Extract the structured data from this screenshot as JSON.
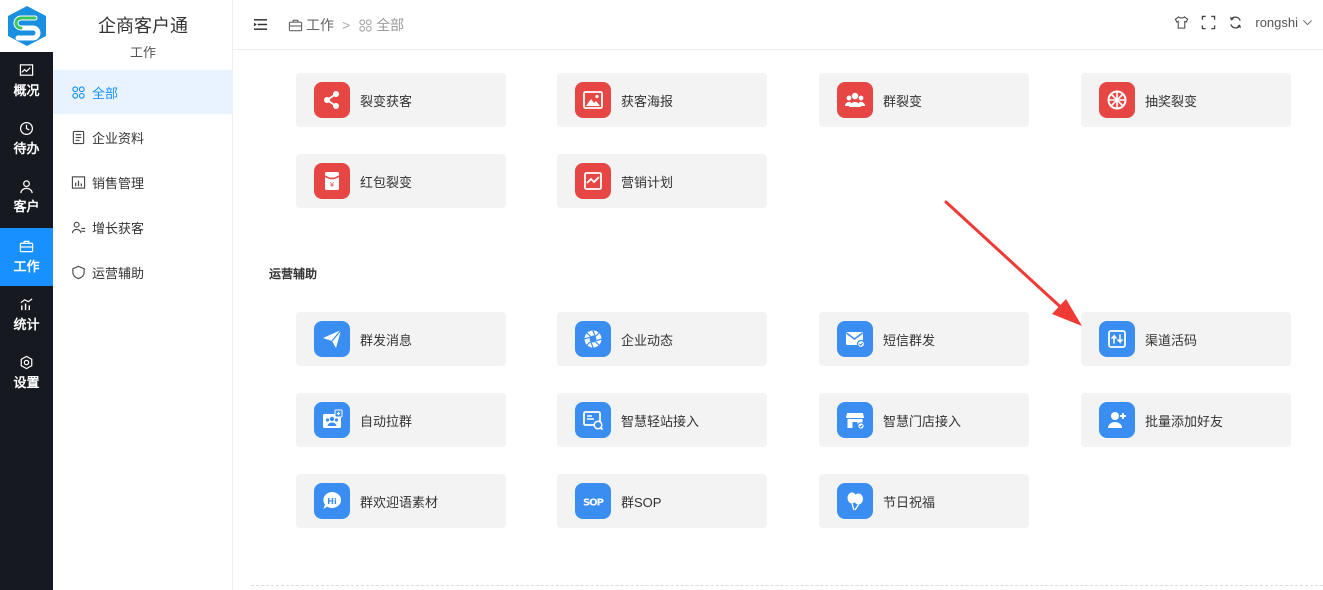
{
  "rail": {
    "items": [
      {
        "label": "概况",
        "icon": "chart-icon"
      },
      {
        "label": "待办",
        "icon": "clock-icon"
      },
      {
        "label": "客户",
        "icon": "user-icon"
      },
      {
        "label": "工作",
        "icon": "briefcase-icon"
      },
      {
        "label": "统计",
        "icon": "stats-icon"
      },
      {
        "label": "设置",
        "icon": "gear-icon"
      }
    ],
    "active_index": 3
  },
  "sidebar": {
    "brand": "企商客户通",
    "subtitle": "工作",
    "items": [
      {
        "label": "全部",
        "icon": "grid-icon"
      },
      {
        "label": "企业资料",
        "icon": "document-icon"
      },
      {
        "label": "销售管理",
        "icon": "chart-board-icon"
      },
      {
        "label": "增长获客",
        "icon": "users-icon"
      },
      {
        "label": "运营辅助",
        "icon": "shield-icon"
      }
    ],
    "active_index": 0
  },
  "header": {
    "breadcrumb": [
      "工作",
      "全部"
    ],
    "separator": ">",
    "username": "rongshi"
  },
  "sections": {
    "growth": {
      "cards": [
        {
          "label": "裂变获客",
          "icon": "share-icon",
          "color": "red"
        },
        {
          "label": "获客海报",
          "icon": "image-icon",
          "color": "red"
        },
        {
          "label": "群裂变",
          "icon": "group-icon",
          "color": "red"
        },
        {
          "label": "抽奖裂变",
          "icon": "wheel-icon",
          "color": "red"
        },
        {
          "label": "红包裂变",
          "icon": "red-envelope-icon",
          "color": "red"
        },
        {
          "label": "营销计划",
          "icon": "plan-chart-icon",
          "color": "red"
        }
      ]
    },
    "operations": {
      "title": "运营辅助",
      "cards": [
        {
          "label": "群发消息",
          "icon": "send-icon",
          "color": "blue"
        },
        {
          "label": "企业动态",
          "icon": "aperture-icon",
          "color": "blue"
        },
        {
          "label": "短信群发",
          "icon": "mail-icon",
          "color": "blue"
        },
        {
          "label": "渠道活码",
          "icon": "qrcode-icon",
          "color": "blue"
        },
        {
          "label": "自动拉群",
          "icon": "group-add-icon",
          "color": "blue"
        },
        {
          "label": "智慧轻站接入",
          "icon": "site-icon",
          "color": "blue"
        },
        {
          "label": "智慧门店接入",
          "icon": "store-icon",
          "color": "blue"
        },
        {
          "label": "批量添加好友",
          "icon": "add-friend-icon",
          "color": "blue"
        },
        {
          "label": "群欢迎语素材",
          "icon": "hi-icon",
          "color": "blue"
        },
        {
          "label": "群SOP",
          "icon": "sop-icon",
          "color": "blue"
        },
        {
          "label": "节日祝福",
          "icon": "balloon-icon",
          "color": "blue"
        }
      ]
    }
  },
  "colors": {
    "accent": "#1890ff",
    "red": "#e74744",
    "blue": "#3a8ef2",
    "rail": "#16191f",
    "arrow": "#f03a35"
  }
}
